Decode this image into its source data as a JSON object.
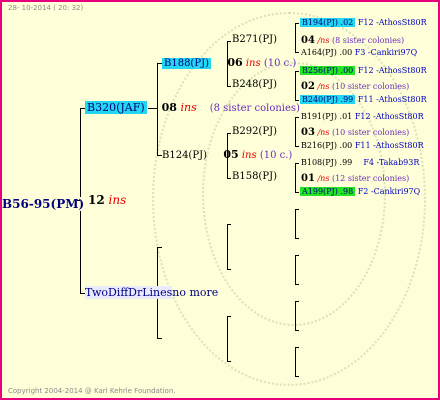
{
  "header": {
    "date": "28- 10-2014 ( 20: 32)"
  },
  "footer": {
    "copyright": "Copyright 2004-2014 @ Karl Kehrle Foundation."
  },
  "root": {
    "label": "B56-95(PM)",
    "count": "12",
    "ins": "ins"
  },
  "gen1": [
    {
      "label": "B320(JAF)",
      "count": "08",
      "ins": "ins",
      "sisters": "(8 sister colonies)"
    },
    {
      "label": "TwoDiffDrLines",
      "note": "no more"
    }
  ],
  "gen2": [
    {
      "label": "B188(PJ)",
      "count": "06",
      "ins": "ins",
      "sisters": "(10 c.)"
    },
    {
      "label": "B124(PJ)",
      "count": "05",
      "ins": "ins",
      "sisters": "(10 c.)"
    }
  ],
  "gen3": [
    {
      "label": "B271(PJ)",
      "count": "04",
      "ins": "/ns",
      "sisters": "(8 sister colonies)"
    },
    {
      "label": "B248(PJ)",
      "count": "02",
      "ins": "/ns",
      "sisters": "(10 sister colonies)"
    },
    {
      "label": "B292(PJ)",
      "count": "03",
      "ins": "/ns",
      "sisters": "(10 sister colonies)"
    },
    {
      "label": "B158(PJ)",
      "count": "01",
      "ins": "/ns",
      "sisters": "(12 sister colonies)"
    }
  ],
  "gen4": [
    {
      "label": "B194(PJ)",
      "value": ".02",
      "line": "F12 -AthosSt80R"
    },
    {
      "label": "A164(PJ)",
      "value": ".00",
      "line": "F3 -Cankiri97Q"
    },
    {
      "label": "B256(PJ)",
      "value": ".00",
      "line": "F12 -AthosSt80R"
    },
    {
      "label": "B240(PJ)",
      "value": ".99",
      "line": "F11 -AthosSt80R"
    },
    {
      "label": "B191(PJ)",
      "value": ".01",
      "line": "F12 -AthosSt80R"
    },
    {
      "label": "B216(PJ)",
      "value": ".00",
      "line": "F11 -AthosSt80R"
    },
    {
      "label": "B108(PJ)",
      "value": ".99",
      "line": "F4 -Takab93R"
    },
    {
      "label": "A199(PJ)",
      "value": ".98",
      "line": "F2 -Cankiri97Q"
    }
  ],
  "colors": {
    "border": "#e6007e",
    "background": "#fefed8",
    "highlight_cyan": "#22d7f0",
    "highlight_green": "#22e622",
    "ins": "#e60000"
  }
}
